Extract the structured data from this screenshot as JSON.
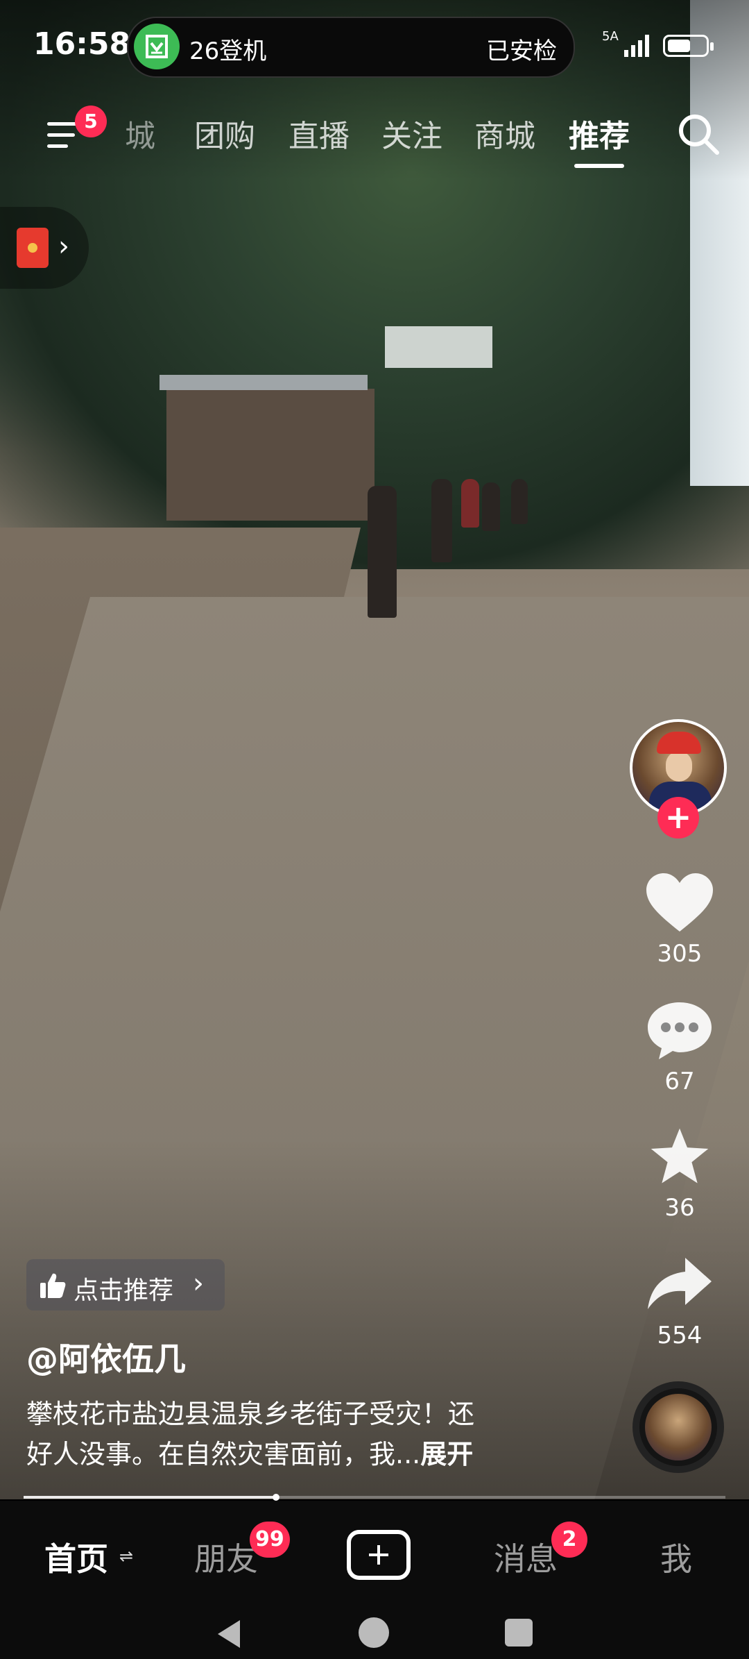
{
  "status_bar": {
    "time": "16:58",
    "island_left": "26登机",
    "island_right": "已安检",
    "network": "5A",
    "battery_level": 0.6
  },
  "top_nav": {
    "menu_badge": "5",
    "tabs": [
      "城",
      "团购",
      "直播",
      "关注",
      "商城",
      "推荐"
    ],
    "active_tab": "推荐"
  },
  "actions": {
    "likes": "305",
    "comments": "67",
    "favorites": "36",
    "shares": "554"
  },
  "post": {
    "recommend_label": "点击推荐",
    "author": "@阿依伍几",
    "description_line1": "攀枝花市盐边县温泉乡老街子受灾！还",
    "description_line2": "好人没事。在自然灾害面前，我...",
    "expand_label": "展开",
    "progress": 0.36
  },
  "bottom_nav": {
    "home": "首页",
    "friends": "朋友",
    "friends_badge": "99",
    "messages": "消息",
    "messages_badge": "2",
    "me": "我"
  },
  "colors": {
    "accent": "#fe2c55",
    "island_icon": "#3dbb55"
  }
}
